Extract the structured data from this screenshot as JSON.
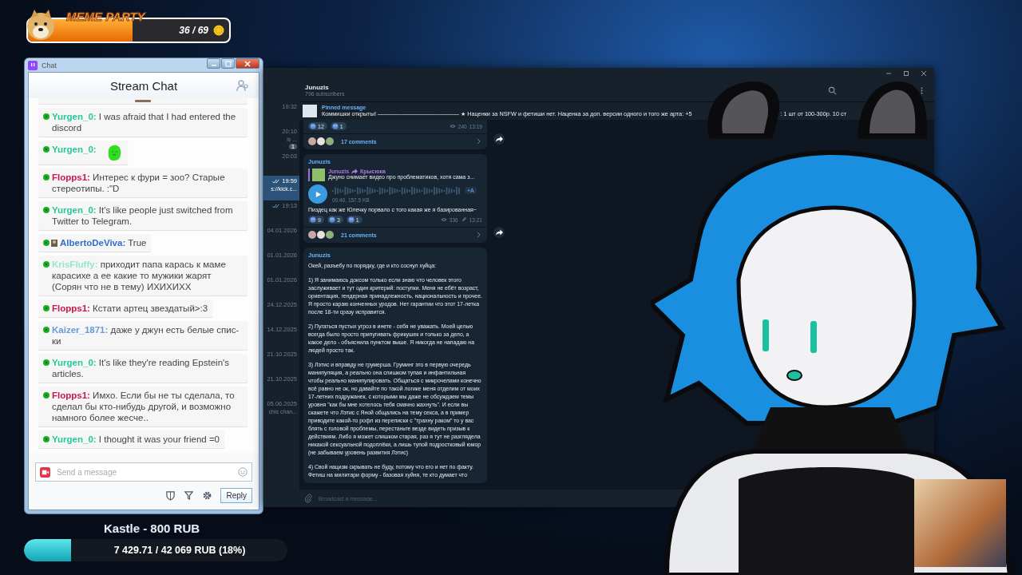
{
  "meme_party": {
    "title": "MEME PARTY",
    "count": "36 / 69",
    "level": 0.52
  },
  "chat_window": {
    "title": "Chat",
    "header": "Stream Chat",
    "messages": [
      {
        "kind": "cut_off"
      },
      {
        "kind": "text",
        "user": "Yurgen_0:",
        "color": "#27c79a",
        "avatar": false,
        "text": "I was afraid that I had entered the discord"
      },
      {
        "kind": "emote",
        "user": "Yurgen_0:",
        "color": "#27c79a",
        "avatar": false
      },
      {
        "kind": "text",
        "user": "Flopps1:",
        "color": "#c8174a",
        "avatar": false,
        "text": "Интерес к фури = зоо? Старые стереотипы. :\"D"
      },
      {
        "kind": "text",
        "user": "Yurgen_0:",
        "color": "#27c79a",
        "avatar": false,
        "text": "It's like people just switched from Twitter to Telegram."
      },
      {
        "kind": "text",
        "user": "AlbertoDeViva:",
        "color": "#2f6fc9",
        "avatar": true,
        "text": "True"
      },
      {
        "kind": "text",
        "user": "KrisFluffy:",
        "color": "#97e6c8",
        "avatar": false,
        "text": "приходит папа карась к маме карасихе а ее какие то мужики жарят (Сорян что не в тему) ИХИХИХХ"
      },
      {
        "kind": "text",
        "user": "Flopps1:",
        "color": "#c8174a",
        "avatar": false,
        "text": "Кстати артец звездатый>:3"
      },
      {
        "kind": "text",
        "user": "Kaizer_1871:",
        "color": "#6a9bd8",
        "avatar": false,
        "text": "даже у джун есть белые спис-ки"
      },
      {
        "kind": "text",
        "user": "Yurgen_0:",
        "color": "#27c79a",
        "avatar": false,
        "text": "It's like they're reading Epstein's articles."
      },
      {
        "kind": "text",
        "user": "Flopps1:",
        "color": "#c8174a",
        "avatar": false,
        "text": "Имхо. Если бы не ты сделала, то сделал бы кто-нибудь другой, и возможно намного более жесче.."
      },
      {
        "kind": "text",
        "user": "Yurgen_0:",
        "color": "#27c79a",
        "avatar": false,
        "text": "I thought it was your friend =0"
      }
    ],
    "input": {
      "placeholder": "Send a message"
    },
    "reply_button": "Reply"
  },
  "goal": {
    "title": "Kastle - 800 RUB",
    "progress": "7 429.71 / 42 069 RUB (18%)",
    "level": 0.18
  },
  "telegram": {
    "channel": "Junuzis",
    "subscribers": "796 subscribers",
    "chats": [
      {
        "time": "19:32",
        "read": false,
        "selected": false
      },
      {
        "snippet": "is ...",
        "time": "20:10",
        "unread": "1",
        "read": false,
        "selected": false
      },
      {
        "time": "20:03",
        "read": false,
        "selected": false
      },
      {
        "time": "19:59",
        "snippet": "s://kick.c...",
        "read": true,
        "selected": true
      },
      {
        "time": "19:13",
        "read": true,
        "selected": false
      },
      {
        "time": "04.01.2026",
        "read": false,
        "selected": false
      },
      {
        "time": "01.01.2026",
        "read": false,
        "selected": false
      },
      {
        "time": "01.01.2026",
        "read": false,
        "selected": false
      },
      {
        "time": "24.12.2025",
        "read": false,
        "selected": false
      },
      {
        "time": "14.12.2025",
        "read": false,
        "selected": false
      },
      {
        "time": "21.10.2025",
        "read": false,
        "selected": false
      },
      {
        "time": "21.10.2025",
        "read": false,
        "selected": false
      },
      {
        "time": "05.06.2025",
        "snippet": "chis chan...",
        "read": false,
        "selected": false
      }
    ],
    "pinned": {
      "label": "Pinned message",
      "text_parts": [
        "Коммишки открыты! —————————————— ★ Наценки за NSFW и фетиши нет. Наценка за доп. версии одного и того же арта: +5",
        ": 1 шт от 100-300р. 10 ст"
      ]
    },
    "posts": [
      {
        "reactions": [
          "12",
          "1"
        ],
        "views": "240",
        "edited": false,
        "time": "13:19",
        "comments": "17 comments"
      },
      {
        "author": "Junuzis",
        "reply": {
          "author": "Junuzis",
          "source": "Крысюка",
          "text": "Джуно снимает видео про проблематиков, хотя сама з..."
        },
        "voice": {
          "transcribe": "+A",
          "info": "00:40, 157.5 KB"
        },
        "text": "Пиздец как же Юлечку порвало с того какая же я базированная~",
        "reactions": [
          "9",
          "3",
          "1"
        ],
        "views": "336",
        "edited": true,
        "time": "13:21",
        "comments": "21 comments"
      },
      {
        "author": "Junuzis",
        "paragraphs": [
          "Окей, разъебу по порядку, где и кто соснул хуйца:",
          "1) Я занимаюсь доксом только если знаю что человек этого заслуживает и тут один критерий: поступки. Меня не ебёт возраст, ориентация, гендерная принадлежность, национальность и прочее. Я просто караю конченных уродов. Нет гарантии что этот 17-летка после 18-ти сразу исправится.",
          "2) Пугаться пустых угроз в инете - себя не уважать. Моей целью всегда было просто припугивать фрикушек и только за дело, а какое дело - объяснила пунктом выше. Я никогда не нападаю на людей просто так.",
          "3) Лэтис и вправду не грумерша. Груминг это в первую очередь манипуляция, а реально она слишком тупая и инфантильная чтобы реально манипулировать. Общаться с микрочелами конечно всё равно не ок, но давайте по такой логике меня отделим от моих 17-летних подружанек, с которыми мы даже не обсуждаем темы уровня \"как бы мне хотелось тебя смачно жахнуть\". И если вы скажете что Лэтис с Яной общались на тему секса, а в пример приводите какой-то рофл из переписки с \"трахну раком\" то у вас блять с головой проблемы, перестаньте везде видеть призыв к действиям. Либо я может слишком старая, раз я тут не разглядела никакой сексуальной подоплёки, а лишь тупой подростковый юмор (не забываем уровень развития Лэтис)",
          "4) Свой нацизм скрывать не буду, потому что его и нет по факту. Фетиш на милитари форму - базовая хуйня, те кто думает что"
        ]
      }
    ],
    "broadcast": {
      "placeholder": "Broadcast a message..."
    }
  }
}
